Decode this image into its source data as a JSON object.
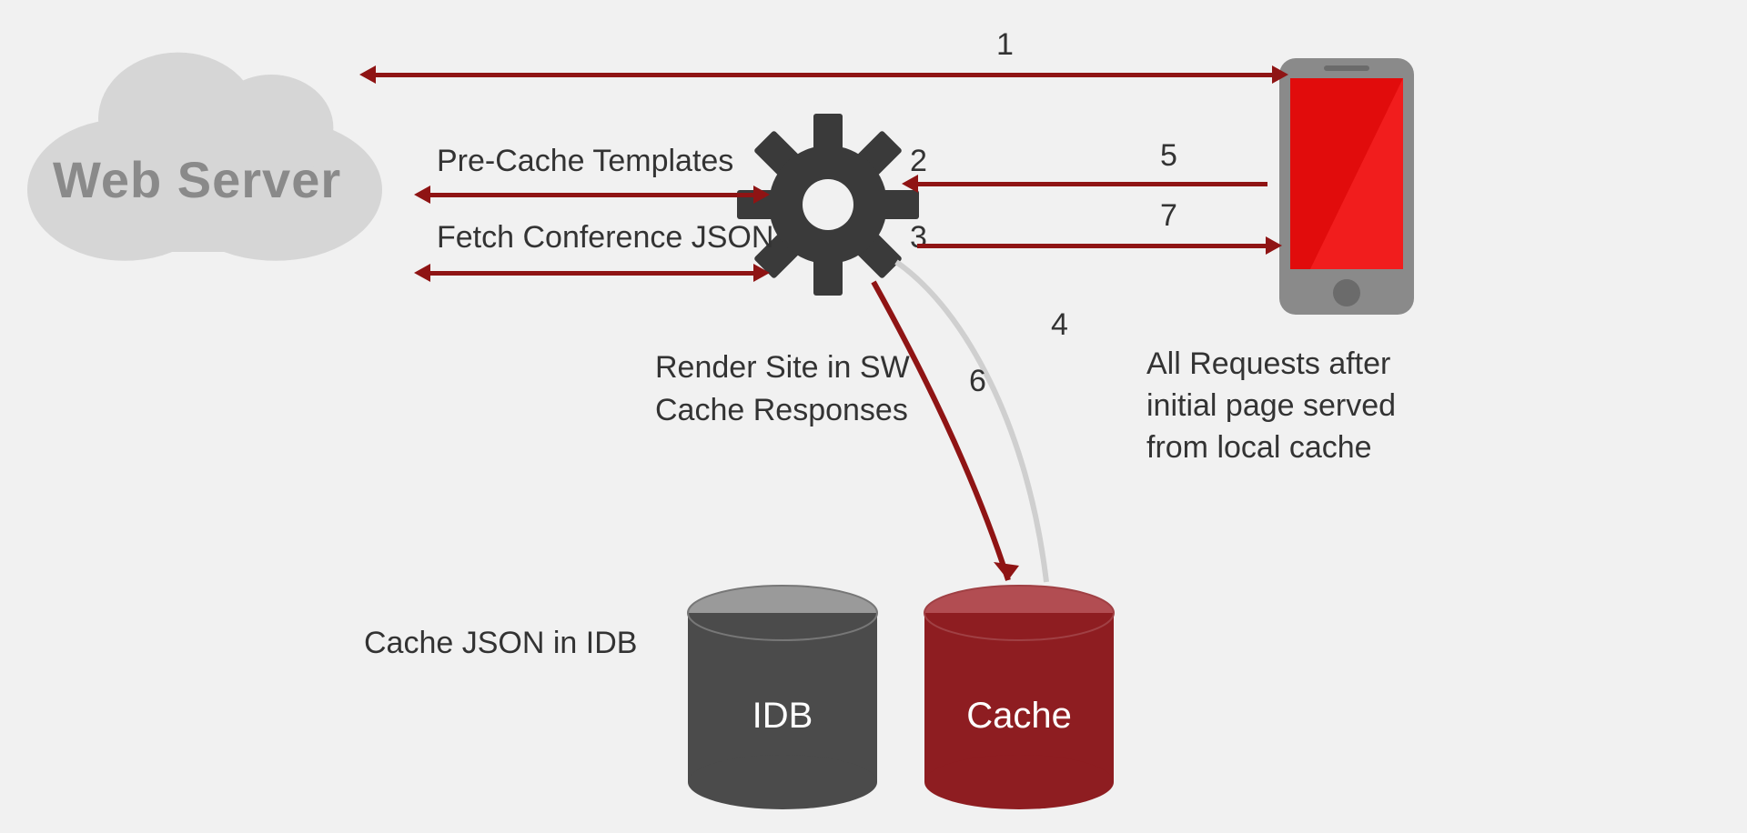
{
  "cloud": {
    "label": "Web Server"
  },
  "arrows": {
    "a1": {
      "num": "1"
    },
    "a2": {
      "num": "2",
      "label": "Pre-Cache Templates"
    },
    "a3": {
      "num": "3",
      "label": "Fetch Conference JSON"
    },
    "a4": {
      "num": "4"
    },
    "a5": {
      "num": "5"
    },
    "a6": {
      "num": "6"
    },
    "a7": {
      "num": "7"
    }
  },
  "captions": {
    "renderSite": "Render Site in SW",
    "cacheResponses": "Cache Responses",
    "cacheJsonIdb": "Cache JSON in IDB",
    "rightNote": "All Requests after initial page served from local cache"
  },
  "cylinders": {
    "idb": {
      "label": "IDB"
    },
    "cache": {
      "label": "Cache"
    }
  },
  "colors": {
    "arrow": "#8f1414",
    "gear": "#3a3a3a",
    "cloud": "#d6d6d6",
    "cloudText": "#8a8a8a",
    "idbFill": "#4b4b4b",
    "idbTop": "#9a9a9a",
    "cacheFill": "#8e1d21",
    "cacheTop": "#b24d52",
    "phoneScreen": "#e10c0c",
    "phoneBody": "#8a8a8a"
  }
}
